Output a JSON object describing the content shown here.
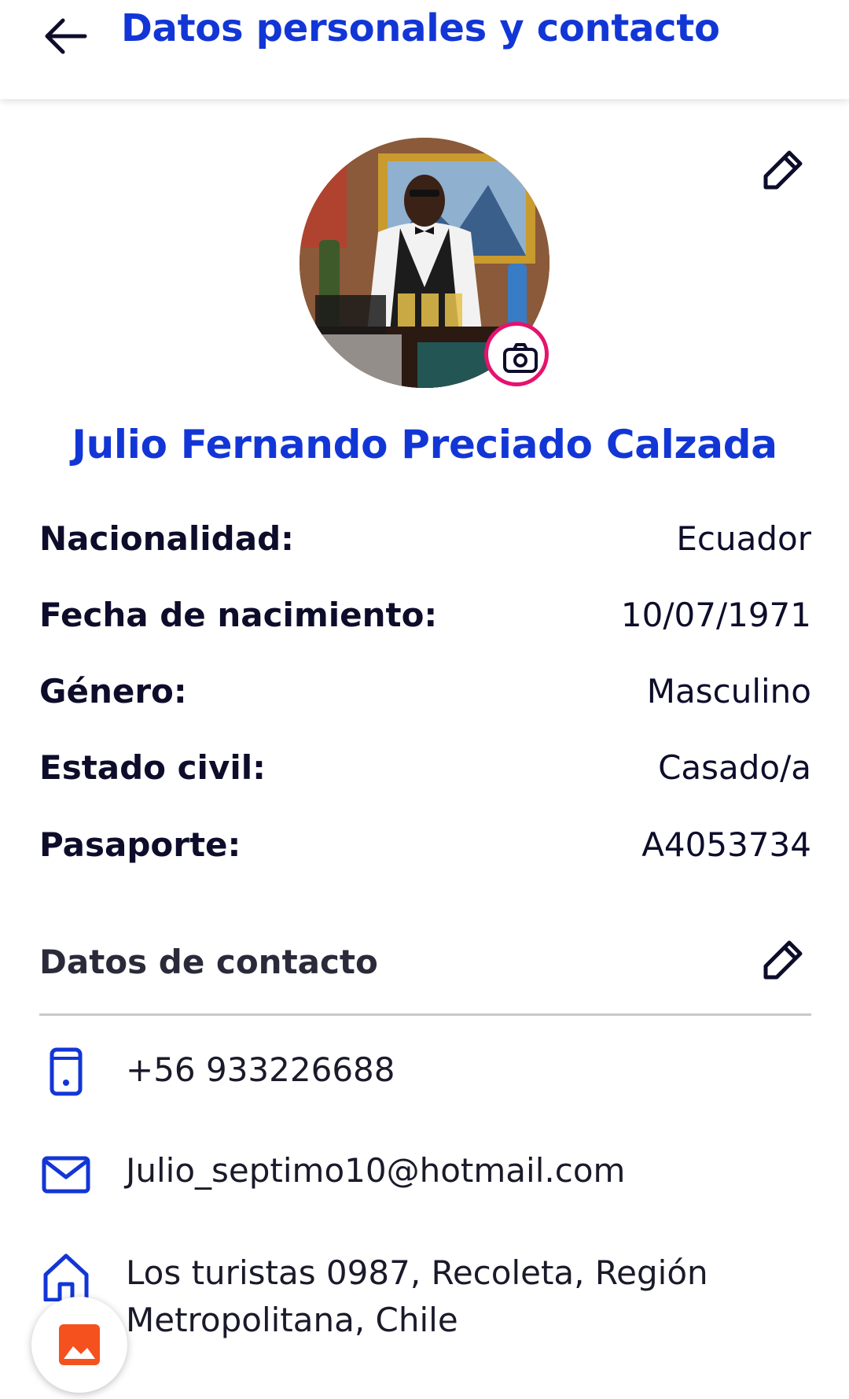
{
  "header": {
    "title": "Datos personales y contacto",
    "back_icon": "arrow-left-icon"
  },
  "profile": {
    "full_name": "Julio Fernando Preciado Calzada",
    "avatar_alt": "profile photo",
    "camera_icon": "camera-icon",
    "edit_icon": "pencil-icon"
  },
  "personal_info": [
    {
      "label": "Nacionalidad:",
      "value": "Ecuador"
    },
    {
      "label": "Fecha de nacimiento:",
      "value": "10/07/1971"
    },
    {
      "label": "Género:",
      "value": "Masculino"
    },
    {
      "label": "Estado civil:",
      "value": "Casado/a"
    },
    {
      "label": "Pasaporte:",
      "value": "A4053734"
    }
  ],
  "contact": {
    "section_title": "Datos de contacto",
    "edit_icon": "pencil-icon",
    "phone": "+56 933226688",
    "email": "Julio_septimo10@hotmail.com",
    "address_line1": "Los turistas 0987, Recoleta, Región",
    "address_line2": "Metropolitana, Chile"
  },
  "fab": {
    "icon": "image-icon"
  },
  "colors": {
    "primary": "#1236d6",
    "accent": "#e5126e",
    "fab_icon": "#f4511e",
    "text": "#0d0d2b"
  }
}
